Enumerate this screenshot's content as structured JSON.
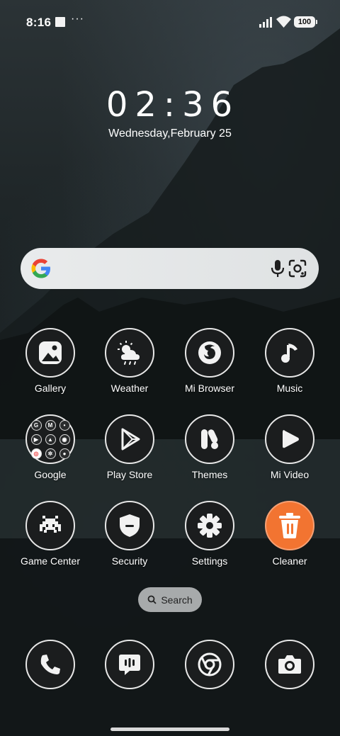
{
  "status_bar": {
    "time": "8:16",
    "more": "···",
    "battery": "100"
  },
  "lock_clock": {
    "time": "02:36",
    "date": "Wednesday,February 25"
  },
  "search_widget": {
    "provider": "Google"
  },
  "apps": [
    {
      "label": "Gallery",
      "icon": "gallery-icon"
    },
    {
      "label": "Weather",
      "icon": "weather-icon"
    },
    {
      "label": "Mi Browser",
      "icon": "mi-browser-icon"
    },
    {
      "label": "Music",
      "icon": "music-icon"
    },
    {
      "label": "Google",
      "icon": "google-folder-icon"
    },
    {
      "label": "Play Store",
      "icon": "play-store-icon"
    },
    {
      "label": "Themes",
      "icon": "themes-icon"
    },
    {
      "label": "Mi Video",
      "icon": "mi-video-icon"
    },
    {
      "label": "Game Center",
      "icon": "game-center-icon"
    },
    {
      "label": "Security",
      "icon": "security-icon"
    },
    {
      "label": "Settings",
      "icon": "settings-icon"
    },
    {
      "label": "Cleaner",
      "icon": "cleaner-icon"
    }
  ],
  "drawer_search": {
    "label": "Search"
  },
  "dock": [
    {
      "icon": "phone-icon"
    },
    {
      "icon": "messages-icon"
    },
    {
      "icon": "chrome-icon"
    },
    {
      "icon": "camera-icon"
    }
  ],
  "colors": {
    "icon_bg": "#1b1d1e",
    "icon_border": "#e7e7e7",
    "cleaner_accent": "#f27431"
  }
}
